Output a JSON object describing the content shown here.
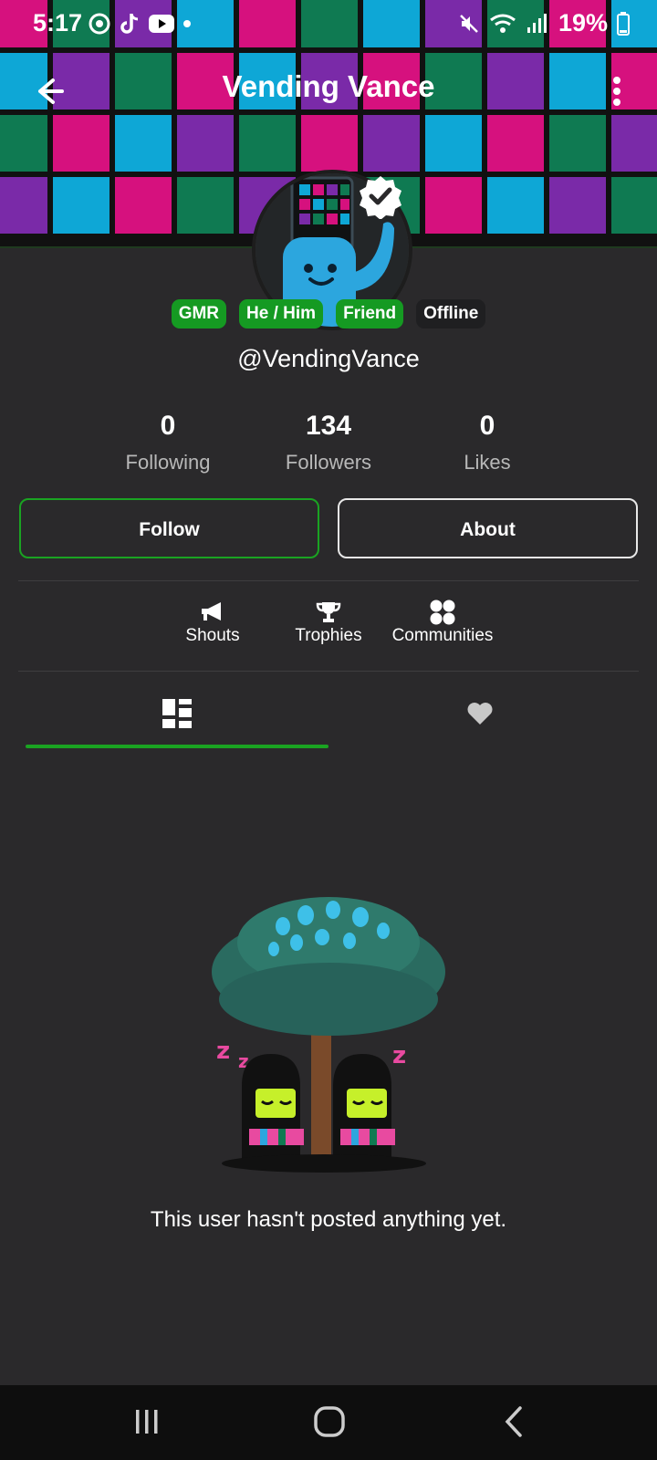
{
  "status_bar": {
    "time": "5:17",
    "battery": "19%",
    "icons": [
      "pocket-casts-icon",
      "tiktok-icon",
      "youtube-icon",
      "dot-icon",
      "mute-icon",
      "wifi-icon",
      "signal-icon",
      "battery-icon"
    ]
  },
  "header": {
    "title": "Vending Vance",
    "back_icon": "arrow-left-icon",
    "menu_icon": "more-vertical-icon"
  },
  "profile": {
    "handle": "@VendingVance",
    "verified": true,
    "badges": [
      {
        "label": "GMR",
        "style": "green"
      },
      {
        "label": "He / Him",
        "style": "green"
      },
      {
        "label": "Friend",
        "style": "green"
      },
      {
        "label": "Offline",
        "style": "dark"
      }
    ]
  },
  "stats": [
    {
      "value": "0",
      "label": "Following"
    },
    {
      "value": "134",
      "label": "Followers"
    },
    {
      "value": "0",
      "label": "Likes"
    }
  ],
  "actions": {
    "follow_label": "Follow",
    "about_label": "About"
  },
  "sections": [
    {
      "label": "Shouts",
      "icon": "megaphone-icon"
    },
    {
      "label": "Trophies",
      "icon": "trophy-icon"
    },
    {
      "label": "Communities",
      "icon": "communities-icon"
    }
  ],
  "feed_tabs": [
    {
      "icon": "posts-grid-icon",
      "active": true
    },
    {
      "icon": "heart-icon",
      "active": false
    }
  ],
  "empty_state": {
    "message": "This user hasn't posted anything yet."
  },
  "system_nav": [
    "recents-icon",
    "home-icon",
    "back-icon"
  ],
  "colors": {
    "background": "#2a292b",
    "accent_green": "#159a22",
    "banner_tiles": [
      "#d6117e",
      "#7a2aa8",
      "#0ea7d6",
      "#0f7a52"
    ]
  }
}
